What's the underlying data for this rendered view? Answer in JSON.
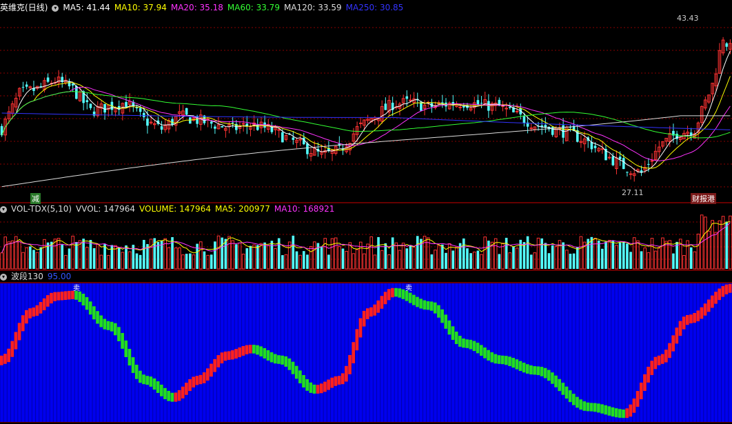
{
  "main": {
    "stock_name": "英维克",
    "period": "(日线)",
    "ma": [
      {
        "label": "MA5: 41.44",
        "color": "#ffffff"
      },
      {
        "label": "MA10: 37.94",
        "color": "#ffff00"
      },
      {
        "label": "MA20: 35.18",
        "color": "#ff33ff"
      },
      {
        "label": "MA60: 33.79",
        "color": "#33ff33"
      },
      {
        "label": "MA120: 33.59",
        "color": "#dddddd"
      },
      {
        "label": "MA250: 30.85",
        "color": "#3333ff"
      }
    ],
    "high_label": "43.43",
    "low_label": "27.11",
    "event_label_left": "减",
    "event_label_right": "财报",
    "event_label_right2": "港",
    "price_range": [
      25,
      46
    ]
  },
  "volume": {
    "title": "VOL-TDX(5,10)",
    "items": [
      {
        "label": "VVOL: 147964",
        "color": "#dddddd"
      },
      {
        "label": "VOLUME: 147964",
        "color": "#ffff00"
      },
      {
        "label": "MA5: 200977",
        "color": "#ffff00"
      },
      {
        "label": "MA10: 168921",
        "color": "#ff33ff"
      }
    ]
  },
  "wave": {
    "title": "波段130",
    "value": "95.00",
    "value_color": "#3355ff",
    "mark_buy": "买",
    "mark_sell": "卖"
  },
  "colors": {
    "up": "#ff3333",
    "down": "#54ffff",
    "grid": "#8b0000",
    "wave_bg": "#0000ee",
    "wave_up": "#ff2020",
    "wave_down": "#22dd22"
  },
  "chart_data": {
    "type": "candlestick",
    "ylim": [
      25,
      46
    ],
    "annotations": [
      {
        "text": "43.43",
        "kind": "high"
      },
      {
        "text": "27.11",
        "kind": "low"
      }
    ],
    "wave_ylim": [
      0,
      100
    ],
    "wave_last": 95.0,
    "wave_points": [
      {
        "i": 0,
        "v": 45
      },
      {
        "i": 8,
        "v": 80
      },
      {
        "i": 15,
        "v": 92
      },
      {
        "i": 20,
        "v": 93
      },
      {
        "i": 30,
        "v": 70
      },
      {
        "i": 40,
        "v": 30
      },
      {
        "i": 48,
        "v": 17
      },
      {
        "i": 55,
        "v": 30
      },
      {
        "i": 63,
        "v": 48
      },
      {
        "i": 70,
        "v": 53
      },
      {
        "i": 78,
        "v": 45
      },
      {
        "i": 88,
        "v": 23
      },
      {
        "i": 95,
        "v": 30
      },
      {
        "i": 103,
        "v": 80
      },
      {
        "i": 110,
        "v": 95
      },
      {
        "i": 120,
        "v": 85
      },
      {
        "i": 130,
        "v": 57
      },
      {
        "i": 140,
        "v": 45
      },
      {
        "i": 150,
        "v": 37
      },
      {
        "i": 165,
        "v": 10
      },
      {
        "i": 175,
        "v": 5
      },
      {
        "i": 185,
        "v": 45
      },
      {
        "i": 193,
        "v": 75
      },
      {
        "i": 205,
        "v": 98
      }
    ],
    "candle_count": 206
  }
}
